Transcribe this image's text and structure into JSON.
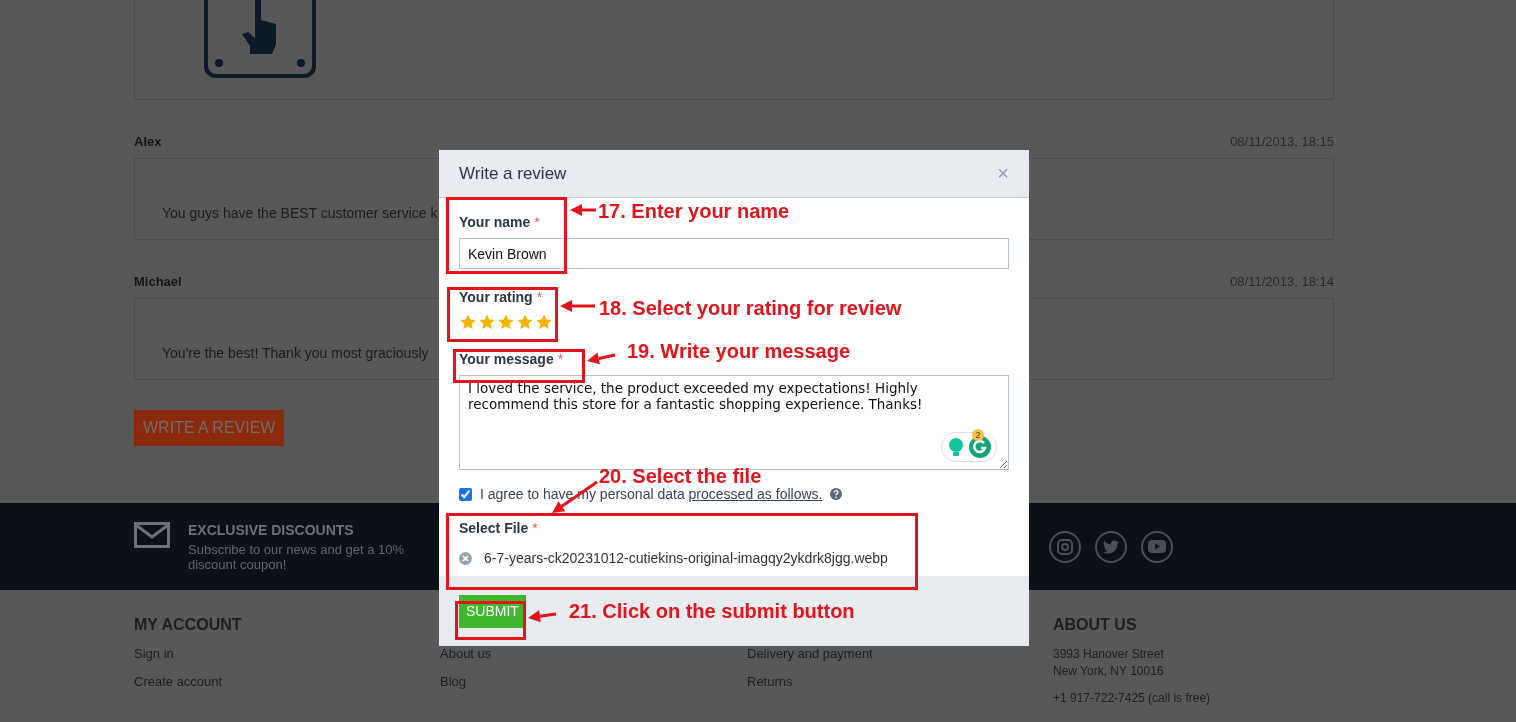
{
  "page": {
    "reviews": [
      {
        "author": "Alex",
        "date": "08/11/2013, 18:15",
        "text": "You guys have the BEST customer service k"
      },
      {
        "author": "Michael",
        "date": "08/11/2013, 18:14",
        "text": "You're the best! Thank you most graciously"
      }
    ],
    "write_review_button": "WRITE A REVIEW",
    "newsletter": {
      "title": "EXCLUSIVE DISCOUNTS",
      "text": "Subscribe to our news and get a 10% discount coupon!"
    },
    "footer_columns": [
      {
        "heading": "MY ACCOUNT",
        "links": [
          "Sign in",
          "Create account"
        ]
      },
      {
        "links": [
          "About us",
          "Blog"
        ]
      },
      {
        "links": [
          "Delivery and payment",
          "Returns"
        ]
      },
      {
        "heading": "ABOUT US",
        "lines": [
          "3993 Hanover Street",
          "New York, NY 10016",
          "+1 917-722-7425 (call is free)"
        ]
      }
    ]
  },
  "dialog": {
    "title": "Write a review",
    "close": "×",
    "name_field": {
      "label": "Your name",
      "required_mark": "*",
      "value": "Kevin Brown"
    },
    "rating": {
      "label": "Your rating",
      "required_mark": "*",
      "stars": 5
    },
    "message": {
      "label": "Your message",
      "required_mark": "*",
      "value": "I loved the service, the product exceeded my expectations! Highly recommend this store for a fantastic shopping experience. Thanks!",
      "badge": "2"
    },
    "consent": {
      "checked": true,
      "text": "I agree to have my personal data",
      "link": "processed as follows."
    },
    "file": {
      "label": "Select File",
      "required_mark": "*",
      "filename": "6-7-years-ck20231012-cutiekins-original-imagqy2ykdrk8jgg.webp"
    },
    "submit": "SUBMIT"
  },
  "annotations": [
    {
      "text": "17. Enter your name"
    },
    {
      "text": "18. Select your rating for review"
    },
    {
      "text": "19. Write your message"
    },
    {
      "text": "20. Select the file"
    },
    {
      "text": "21. Click on the submit button"
    }
  ]
}
